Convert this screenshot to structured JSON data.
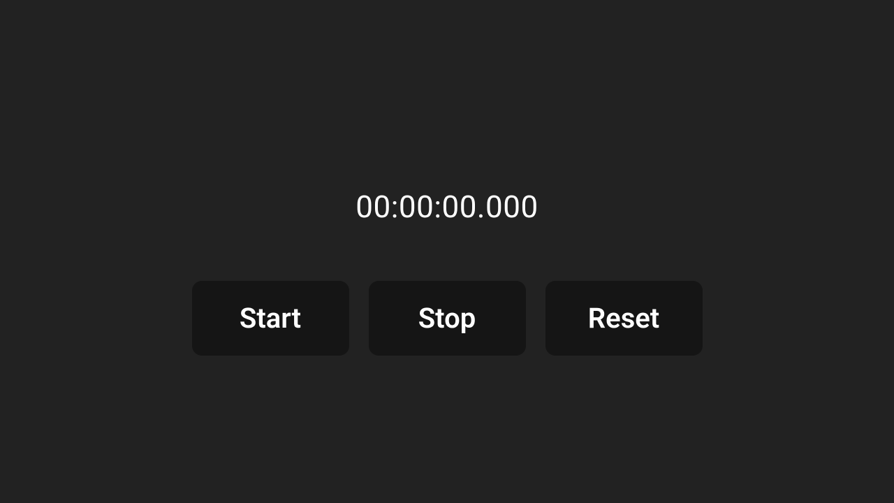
{
  "timer": {
    "display": "00:00:00.000"
  },
  "buttons": {
    "start": "Start",
    "stop": "Stop",
    "reset": "Reset"
  }
}
